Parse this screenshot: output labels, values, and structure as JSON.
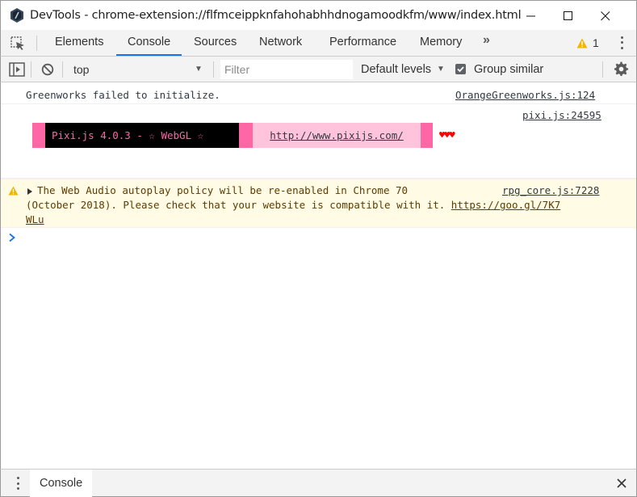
{
  "window": {
    "title": "DevTools - chrome-extension://flfmceippknfahohabhhdnogamoodkfm/www/index.html"
  },
  "tabs": [
    {
      "label": "Elements"
    },
    {
      "label": "Console"
    },
    {
      "label": "Sources"
    },
    {
      "label": "Network"
    },
    {
      "label": "Performance"
    },
    {
      "label": "Memory"
    }
  ],
  "tabbar": {
    "more_label": "»",
    "warning_count": "1"
  },
  "toolbar": {
    "context": "top",
    "filter_placeholder": "Filter",
    "levels": "Default levels",
    "group_similar": "Group similar",
    "group_similar_checked": true
  },
  "messages": {
    "m1": {
      "text": "Greenworks failed to initialize.",
      "source": "OrangeGreenworks.js:124"
    },
    "m2": {
      "source": "pixi.js:24595",
      "banner": "Pixi.js 4.0.3 - ☆ WebGL ☆",
      "link": "http://www.pixijs.com/",
      "hearts": "♥♥♥"
    },
    "m3": {
      "line1": "The Web Audio autoplay policy will be re-enabled in Chrome 70",
      "line2": "(October 2018). Please check that your website is compatible with it. ",
      "link_part1": "https://goo.gl/7K7",
      "link_part2": "WLu",
      "source": "rpg_core.js:7228"
    }
  },
  "drawer": {
    "tab": "Console"
  },
  "colors": {
    "accent": "#1a73e8",
    "warning_bg": "#fffbe5",
    "pixi_pink": "#ff66a5",
    "pixi_light_pink": "#ffc3dc"
  }
}
